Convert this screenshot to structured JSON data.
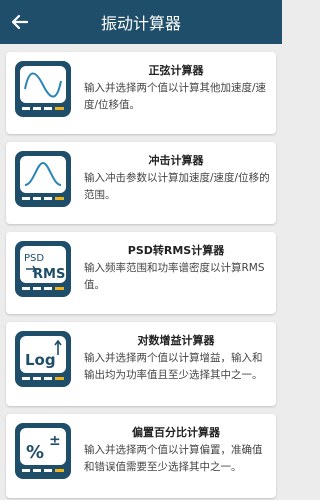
{
  "header": {
    "title": "振动计算器",
    "back_icon": "arrow-left-icon"
  },
  "cards": [
    {
      "title": "正弦计算器",
      "description": "输入并选择两个值以计算其他加速度/速度/位移值。",
      "icon": "sine-wave-icon"
    },
    {
      "title": "冲击计算器",
      "description": "输入冲击参数以计算加速度/速度/位移的范围。",
      "icon": "shock-pulse-icon"
    },
    {
      "title": "PSD转RMS计算器",
      "description": "输入频率范围和功率谱密度以计算RMS值。",
      "icon": "psd-rms-icon",
      "icon_text_top": "PSD",
      "icon_text_bottom": "RMS"
    },
    {
      "title": "对数增益计算器",
      "description": "输入并选择两个值以计算增益，输入和输出均为功率值且至少选择其中之一。",
      "icon": "log-gain-icon",
      "icon_text": "Log"
    },
    {
      "title": "偏置百分比计算器",
      "description": "输入并选择两个值以计算偏置，准确值和错误值需要至少选择其中之一。",
      "icon": "percent-bias-icon",
      "icon_text": "%",
      "icon_symbol": "±"
    }
  ],
  "colors": {
    "header": "#1f4e6a",
    "icon_frame": "#1f4e6a",
    "icon_screen": "#ffffff",
    "accent": "#f2b21b"
  }
}
